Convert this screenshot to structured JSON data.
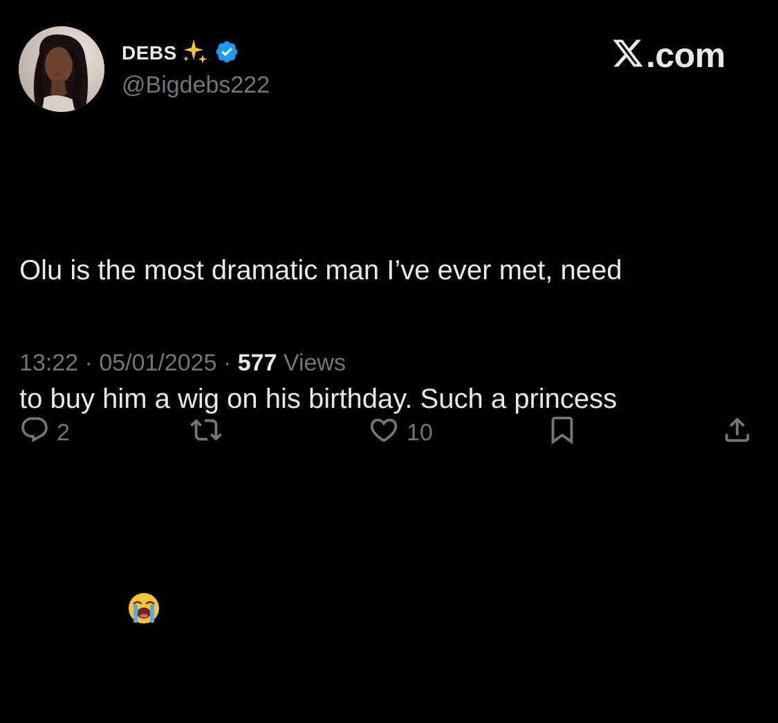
{
  "author": {
    "display_name": "DEBS",
    "handle": "@Bigdebs222",
    "verified": true,
    "badge_icons": [
      "sparkles-icon",
      "verified-badge-icon"
    ],
    "avatar": "profile-photo"
  },
  "site": {
    "logo_text": ".com",
    "logo_icon": "x-logo-icon"
  },
  "tweet": {
    "lines": [
      "Olu is the most dramatic man I’ve ever met, need",
      "to buy him a wig on his birthday. Such a princess"
    ],
    "emoji_icon": "loudly-crying-face-emoji"
  },
  "meta": {
    "time": "13:22",
    "separator": " · ",
    "date": "05/01/2025",
    "views_count": "577",
    "views_label": " Views"
  },
  "actions": {
    "replies": {
      "count": "2",
      "icon": "reply-icon"
    },
    "reposts": {
      "count": "",
      "icon": "repost-icon"
    },
    "likes": {
      "count": "10",
      "icon": "heart-icon"
    },
    "bookmark": {
      "icon": "bookmark-icon"
    },
    "share": {
      "icon": "share-icon"
    }
  },
  "colors": {
    "background": "#000000",
    "primary_text": "#e7e9ea",
    "secondary_text": "#71767b",
    "verified_blue": "#1d9bf0",
    "sparkle_gold": "#f4c542"
  }
}
